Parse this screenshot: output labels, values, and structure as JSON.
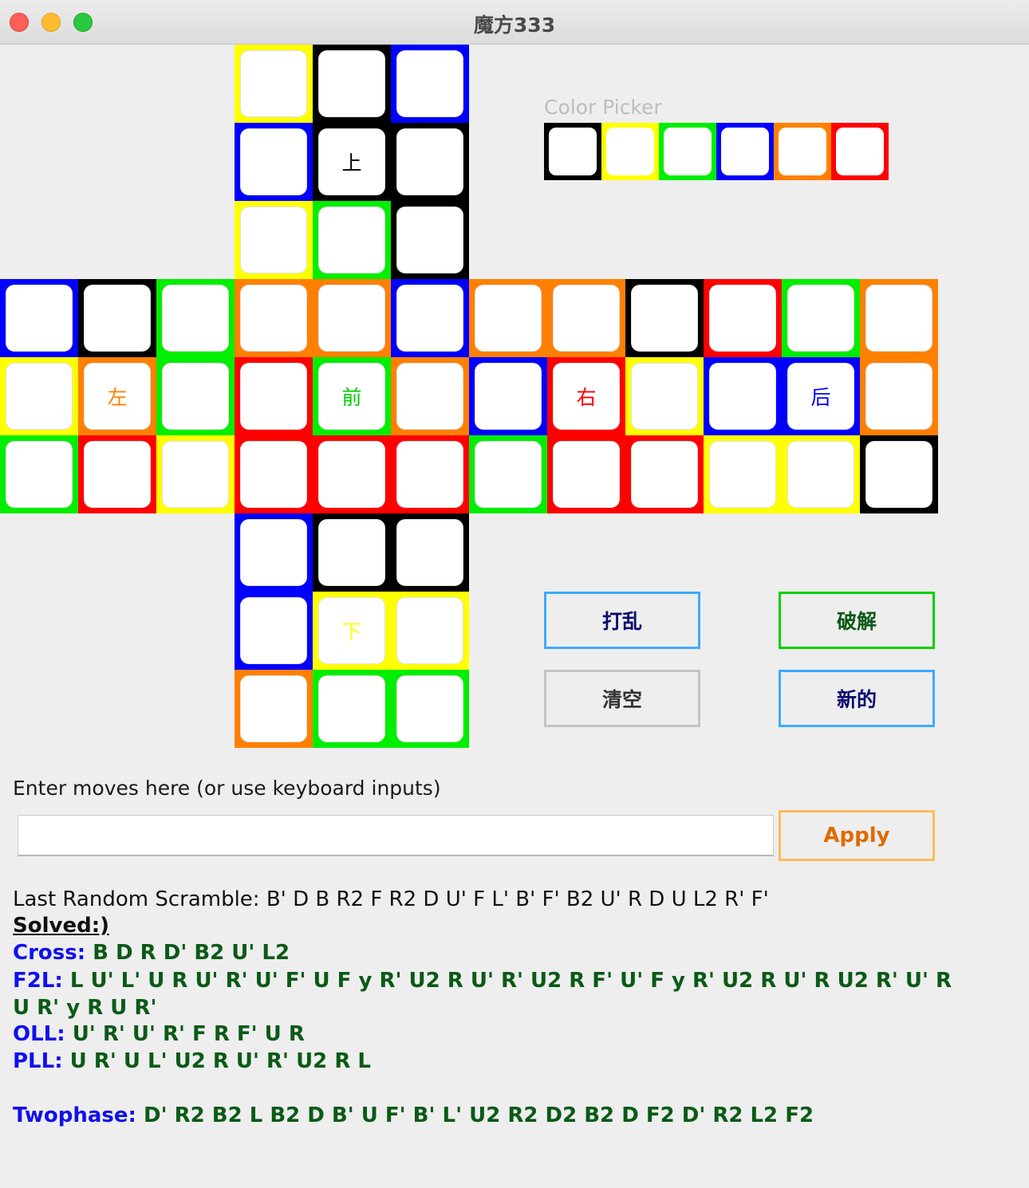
{
  "window": {
    "title": "魔方333"
  },
  "colors": {
    "W": "#000000",
    "Y": "#ffff00",
    "G": "#00ee00",
    "B": "#0000ff",
    "O": "#ff8000",
    "R": "#ff0000"
  },
  "cube": {
    "faces": [
      {
        "id": "up",
        "label": "上",
        "label_color": "#000000",
        "col": 3,
        "row": 0,
        "cells": [
          "Y",
          "W",
          "B",
          "B",
          "W",
          "W",
          "Y",
          "G",
          "W"
        ]
      },
      {
        "id": "left",
        "label": "左",
        "label_color": "#ff8000",
        "col": 0,
        "row": 3,
        "cells": [
          "B",
          "W",
          "G",
          "Y",
          "O",
          "G",
          "G",
          "R",
          "Y"
        ]
      },
      {
        "id": "front",
        "label": "前",
        "label_color": "#00cc00",
        "col": 3,
        "row": 3,
        "cells": [
          "O",
          "O",
          "B",
          "R",
          "G",
          "O",
          "R",
          "R",
          "R"
        ]
      },
      {
        "id": "right",
        "label": "右",
        "label_color": "#ff0000",
        "col": 6,
        "row": 3,
        "cells": [
          "O",
          "O",
          "W",
          "B",
          "R",
          "Y",
          "G",
          "R",
          "R"
        ]
      },
      {
        "id": "back",
        "label": "后",
        "label_color": "#0000ff",
        "col": 9,
        "row": 3,
        "cells": [
          "R",
          "G",
          "O",
          "B",
          "B",
          "O",
          "Y",
          "Y",
          "W"
        ]
      },
      {
        "id": "down",
        "label": "下",
        "label_color": "#ffff00",
        "col": 3,
        "row": 6,
        "cells": [
          "B",
          "W",
          "W",
          "B",
          "Y",
          "Y",
          "O",
          "G",
          "G"
        ]
      }
    ]
  },
  "color_picker": {
    "label": "Color Picker",
    "swatches": [
      "W",
      "Y",
      "G",
      "B",
      "O",
      "R"
    ]
  },
  "buttons": {
    "scramble": {
      "label": "打乱",
      "text_color": "#0a0a6e",
      "border": "#3caaff"
    },
    "solve": {
      "label": "破解",
      "text_color": "#0a5a16",
      "border": "#00d000"
    },
    "clear": {
      "label": "清空",
      "text_color": "#333333",
      "border": "#c4c4c4"
    },
    "new": {
      "label": "新的",
      "text_color": "#0a0a6e",
      "border": "#3caaff"
    }
  },
  "moves": {
    "label": "Enter moves here (or use keyboard inputs)",
    "value": "",
    "apply_label": "Apply"
  },
  "results": {
    "scramble_line": "Last Random Scramble: B' D B R2 F R2 D U' F L' B' F' B2 U' R D U L2 R' F'",
    "solved": "Solved:)",
    "cross_key": "Cross:",
    "cross": " B D R D' B2 U' L2",
    "f2l_key": "F2L:",
    "f2l": " L U' L' U R U' R' U' F' U F y R' U2 R U' R' U2 R F' U' F y R' U2 R U' R U2 R' U' R U R' y R U R'",
    "oll_key": "OLL:",
    "oll": " U' R' U' R' F R F' U R",
    "pll_key": "PLL:",
    "pll": " U R' U L' U2 R U' R' U2 R L",
    "twophase_key": "Twophase:",
    "twophase": " D' R2 B2 L B2 D B' U F' B' L' U2 R2 D2 B2 D F2 D' R2 L2 F2"
  }
}
